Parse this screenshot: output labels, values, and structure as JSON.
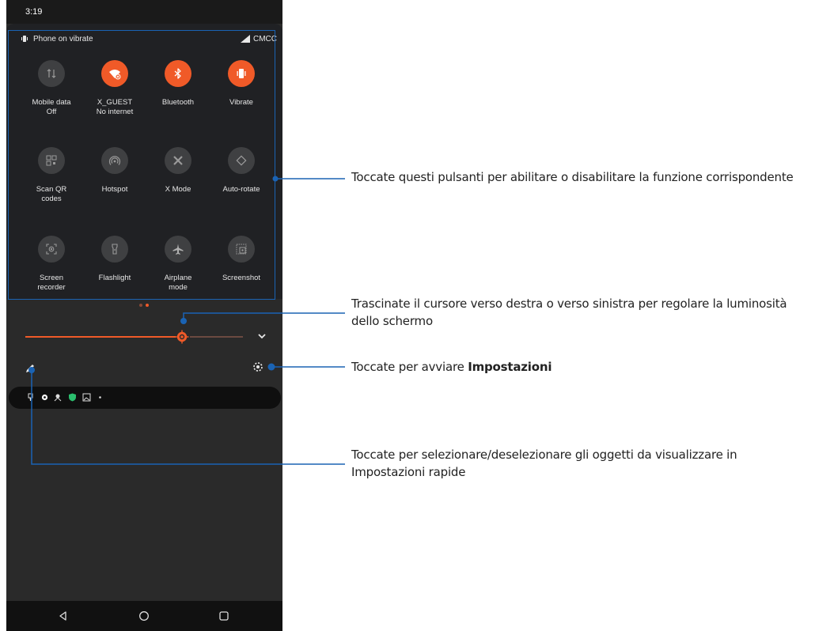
{
  "status_bar": {
    "time": "3:19"
  },
  "qs_header": {
    "status_text": "Phone on vibrate",
    "carrier": "CMCC",
    "icons": [
      "vibrate-icon",
      "signal-icon"
    ]
  },
  "tiles": [
    {
      "label": "Mobile data\nOff",
      "icon": "mobile-data-icon",
      "active": false
    },
    {
      "label": "X_GUEST\nNo internet",
      "icon": "wifi-icon",
      "active": true
    },
    {
      "label": "Bluetooth",
      "icon": "bluetooth-icon",
      "active": true
    },
    {
      "label": "Vibrate",
      "icon": "vibrate-icon",
      "active": true
    },
    {
      "label": "Scan QR\ncodes",
      "icon": "qr-code-icon",
      "active": false
    },
    {
      "label": "Hotspot",
      "icon": "hotspot-icon",
      "active": false
    },
    {
      "label": "X Mode",
      "icon": "x-mode-icon",
      "active": false
    },
    {
      "label": "Auto-rotate",
      "icon": "auto-rotate-icon",
      "active": false
    },
    {
      "label": "Screen\nrecorder",
      "icon": "screen-recorder-icon",
      "active": false
    },
    {
      "label": "Flashlight",
      "icon": "flashlight-icon",
      "active": false
    },
    {
      "label": "Airplane\nmode",
      "icon": "airplane-icon",
      "active": false
    },
    {
      "label": "Screenshot",
      "icon": "screenshot-icon",
      "active": false
    }
  ],
  "pager": {
    "pages": 2,
    "current": 2
  },
  "brightness": {
    "level": 0.72
  },
  "notification_icons": [
    "pin-icon",
    "gear-icon",
    "game-icon",
    "shield-icon",
    "image-icon",
    "more-dot-icon"
  ],
  "nav": [
    "back-icon",
    "home-icon",
    "recents-icon"
  ],
  "annotations": {
    "tiles_text": "Toccate questi pulsanti per abilitare o disabilitare la funzione corrispondente",
    "brightness_text": "Trascinate il cursore verso destra o verso sinistra per regolare la luminosità dello schermo",
    "settings_prefix": "Toccate per avviare ",
    "settings_bold": "Impostazioni",
    "edit_text": "Toccate per selezionare/deselezionare gli oggetti da visualizzare in Impostazioni rapide"
  },
  "colors": {
    "accent": "#f05a28",
    "callout": "#1a63b4",
    "panel": "#202124",
    "tile_off": "#3f4042"
  }
}
